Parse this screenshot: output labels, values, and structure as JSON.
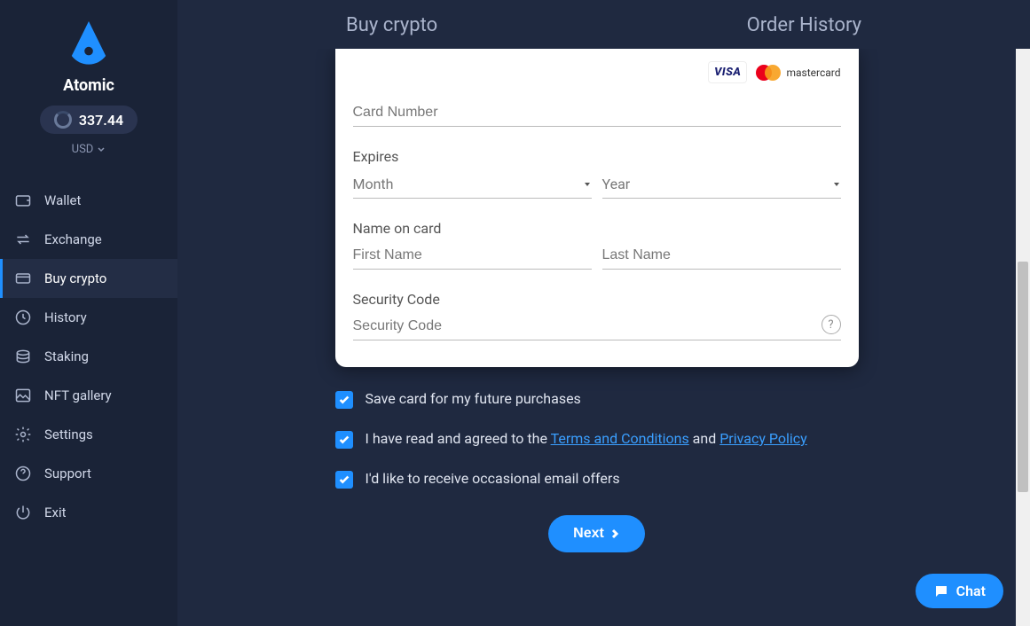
{
  "app": {
    "name": "Atomic"
  },
  "balance": {
    "amount": "337.44",
    "currency": "USD"
  },
  "sidebar": {
    "items": [
      {
        "label": "Wallet"
      },
      {
        "label": "Exchange"
      },
      {
        "label": "Buy crypto"
      },
      {
        "label": "History"
      },
      {
        "label": "Staking"
      },
      {
        "label": "NFT gallery"
      },
      {
        "label": "Settings"
      },
      {
        "label": "Support"
      },
      {
        "label": "Exit"
      }
    ],
    "active_index": 2
  },
  "header": {
    "title": "Buy crypto",
    "order_history": "Order History"
  },
  "card_form": {
    "brand_visa": "VISA",
    "brand_mc": "mastercard",
    "card_number_placeholder": "Card Number",
    "expires_label": "Expires",
    "month_placeholder": "Month",
    "year_placeholder": "Year",
    "name_label": "Name on card",
    "first_name_placeholder": "First Name",
    "last_name_placeholder": "Last Name",
    "security_label": "Security Code",
    "security_placeholder": "Security Code",
    "help_symbol": "?"
  },
  "checks": {
    "save_card": "Save card for my future purchases",
    "agree_prefix": "I have read and agreed to the ",
    "terms": "Terms and Conditions",
    "agree_mid": " and ",
    "privacy": "Privacy Policy",
    "email_offers": "I'd like to receive occasional email offers"
  },
  "next_button": "Next",
  "chat_button": "Chat"
}
